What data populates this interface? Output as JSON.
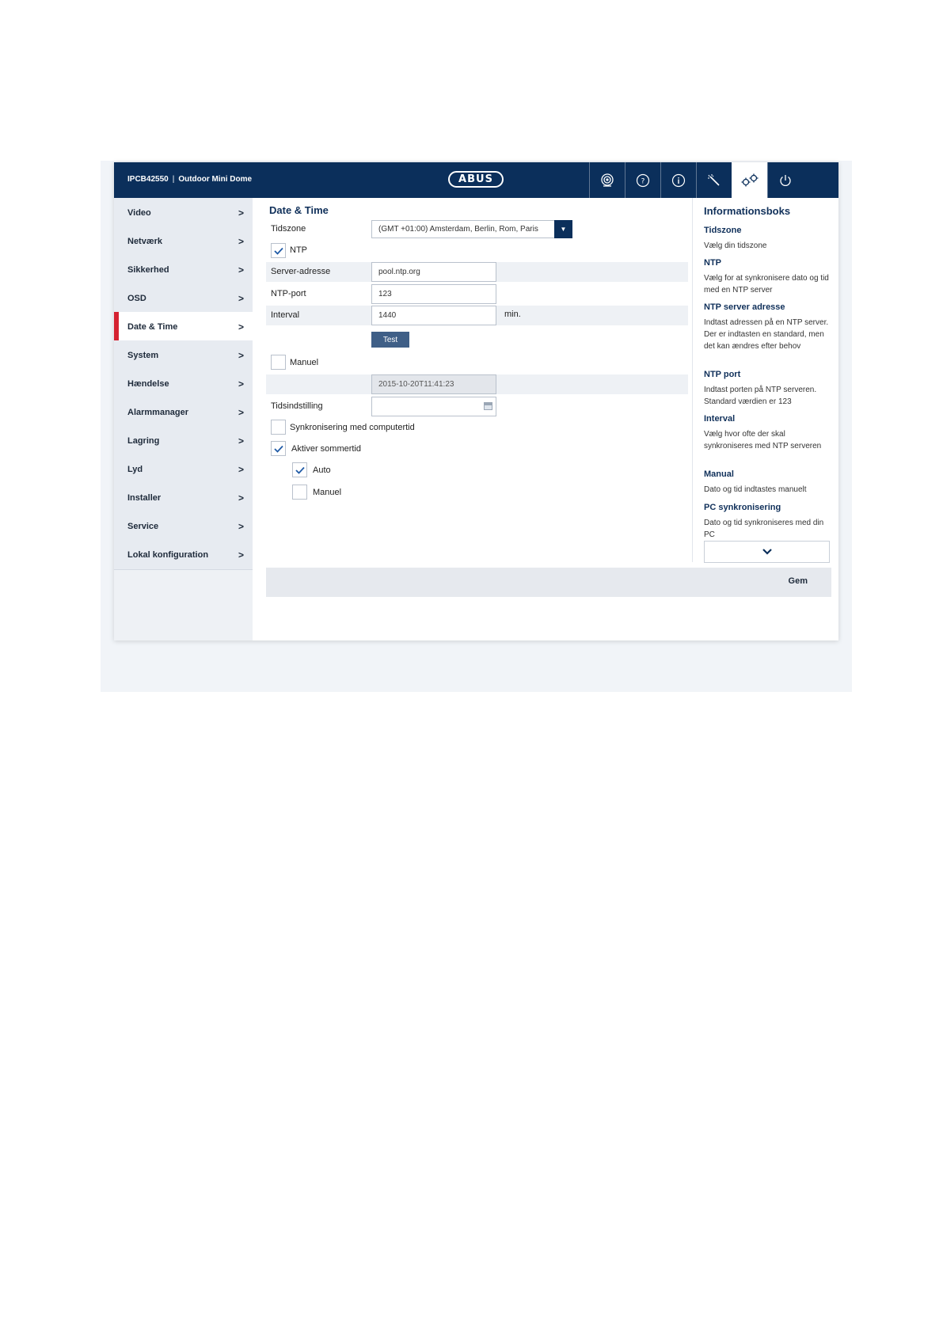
{
  "header": {
    "model": "IPCB42550",
    "separator": "|",
    "device_name": "Outdoor Mini Dome",
    "logo_text": "ABUS",
    "icons": [
      "camera-icon",
      "help-icon",
      "info-icon",
      "wizard-icon",
      "settings-icon",
      "power-icon"
    ],
    "active_icon": "settings-icon"
  },
  "sidebar": {
    "items": [
      {
        "label": "Video",
        "chevron": ">"
      },
      {
        "label": "Netværk",
        "chevron": ">"
      },
      {
        "label": "Sikkerhed",
        "chevron": ">"
      },
      {
        "label": "OSD",
        "chevron": ">"
      },
      {
        "label": "Date & Time",
        "chevron": ">"
      },
      {
        "label": "System",
        "chevron": ">"
      },
      {
        "label": "Hændelse",
        "chevron": ">"
      },
      {
        "label": "Alarmmanager",
        "chevron": ">"
      },
      {
        "label": "Lagring",
        "chevron": ">"
      },
      {
        "label": "Lyd",
        "chevron": ">"
      },
      {
        "label": "Installer",
        "chevron": ">"
      },
      {
        "label": "Service",
        "chevron": ">"
      },
      {
        "label": "Lokal konfiguration",
        "chevron": ">"
      }
    ],
    "active": "Date & Time"
  },
  "main": {
    "title": "Date & Time",
    "timezone": {
      "label": "Tidszone",
      "value": "(GMT +01:00) Amsterdam, Berlin, Rom, Paris"
    },
    "ntp": {
      "label": "NTP",
      "checked": true
    },
    "server_address": {
      "label": "Server-adresse",
      "value": "pool.ntp.org"
    },
    "ntp_port": {
      "label": "NTP-port",
      "value": "123"
    },
    "interval": {
      "label": "Interval",
      "value": "1440",
      "unit": "min."
    },
    "test_label": "Test",
    "manual": {
      "label": "Manuel",
      "checked": false
    },
    "manual_time_value": "2015-10-20T11:41:23",
    "time_setting": {
      "label": "Tidsindstilling",
      "value": ""
    },
    "sync_computer": {
      "label": "Synkronisering med computertid",
      "checked": false
    },
    "dst": {
      "label": "Aktiver sommertid",
      "checked": true
    },
    "dst_auto": {
      "label": "Auto",
      "checked": true
    },
    "dst_manual": {
      "label": "Manuel",
      "checked": false
    },
    "save_label": "Gem"
  },
  "infobox": {
    "title": "Informationsboks",
    "sections": [
      {
        "heading": "Tidszone",
        "text": "Vælg din tidszone"
      },
      {
        "heading": "NTP",
        "text": "Vælg for at synkronisere dato og tid med en NTP server"
      },
      {
        "heading": "NTP server adresse",
        "text": "Indtast adressen på en NTP server.\nDer er indtasten en standard, men det kan ændres efter behov"
      },
      {
        "heading": "NTP port",
        "text": "Indtast porten på NTP serveren. Standard værdien er 123"
      },
      {
        "heading": "Interval",
        "text": "Vælg hvor ofte der skal synkroniseres med NTP serveren"
      },
      {
        "heading": "Manual",
        "text": "Dato og tid indtastes manuelt"
      },
      {
        "heading": "PC synkronisering",
        "text": "Dato og tid synkroniseres med din PC"
      }
    ],
    "scroll_icon": "chevron-down-icon"
  },
  "colors": {
    "header_bg": "#0b2f5b",
    "active_marker": "#d52231",
    "button_bg": "#3f5f87",
    "heading_text": "#10305a"
  }
}
